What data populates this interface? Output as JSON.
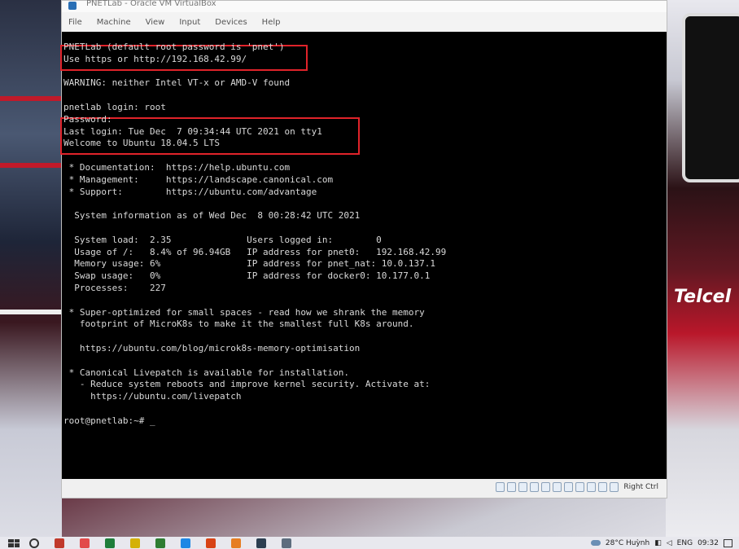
{
  "window": {
    "title": "PNETLab - Oracle VM VirtualBox",
    "menu": [
      "File",
      "Machine",
      "View",
      "Input",
      "Devices",
      "Help"
    ]
  },
  "terminal": {
    "lines": [
      "PNETLab (default root password is 'pnet')",
      "Use https or http://192.168.42.99/",
      "",
      "WARNING: neither Intel VT-x or AMD-V found",
      "",
      "pnetlab login: root",
      "Password:",
      "Last login: Tue Dec  7 09:34:44 UTC 2021 on tty1",
      "Welcome to Ubuntu 18.04.5 LTS",
      "",
      " * Documentation:  https://help.ubuntu.com",
      " * Management:     https://landscape.canonical.com",
      " * Support:        https://ubuntu.com/advantage",
      "",
      "  System information as of Wed Dec  8 00:28:42 UTC 2021",
      "",
      "  System load:  2.35              Users logged in:        0",
      "  Usage of /:   8.4% of 96.94GB   IP address for pnet0:   192.168.42.99",
      "  Memory usage: 6%                IP address for pnet_nat: 10.0.137.1",
      "  Swap usage:   0%                IP address for docker0: 10.177.0.1",
      "  Processes:    227",
      "",
      " * Super-optimized for small spaces - read how we shrank the memory",
      "   footprint of MicroK8s to make it the smallest full K8s around.",
      "",
      "   https://ubuntu.com/blog/microk8s-memory-optimisation",
      "",
      " * Canonical Livepatch is available for installation.",
      "   - Reduce system reboots and improve kernel security. Activate at:",
      "     https://ubuntu.com/livepatch",
      "",
      "root@pnetlab:~# _"
    ]
  },
  "statusbar": {
    "host_key": "Right Ctrl",
    "icons": [
      "hard-disk-icon",
      "optical-drive-icon",
      "audio-icon",
      "network-icon",
      "usb-icon",
      "shared-folder-icon",
      "display-icon",
      "recording-icon",
      "cpu-icon",
      "mouse-integration-icon",
      "keyboard-icon"
    ]
  },
  "taskbar": {
    "weather": "28°C Huỳnh",
    "language": "ENG",
    "time": "09:32",
    "app_colors": [
      "#c0392b",
      "#e24a4a",
      "#1e7d3a",
      "#d4b106",
      "#2e7d32",
      "#1e88e5",
      "#d84315",
      "#e67e22",
      "#2c3e50",
      "#5d6d7e"
    ]
  },
  "wallpaper": {
    "brand_text": "Telcel"
  }
}
